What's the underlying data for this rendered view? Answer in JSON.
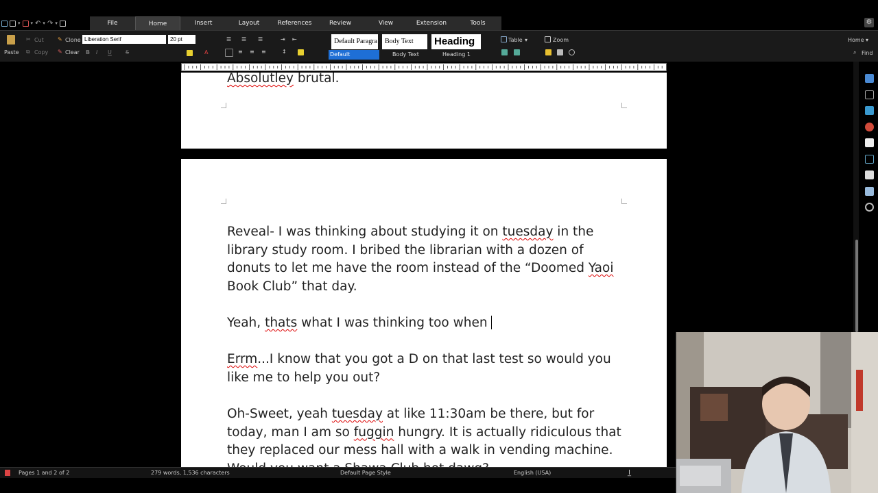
{
  "tabs": [
    "File",
    "Home",
    "Insert",
    "Layout",
    "References",
    "Review",
    "View",
    "Extension",
    "Tools"
  ],
  "active_tab": "Home",
  "ribbon": {
    "cut": "Cut",
    "copy": "Copy",
    "paste": "Paste",
    "clone": "Clone",
    "clear": "Clear",
    "font_name": "Liberation Serif",
    "font_size": "20 pt",
    "styles": [
      {
        "preview": "Default Paragra",
        "label": "Default Paragraph..."
      },
      {
        "preview": "Body Text",
        "label": "Body Text"
      },
      {
        "preview": "Heading",
        "label": "Heading 1"
      }
    ],
    "table": "Table",
    "zoom": "Zoom",
    "home": "Home",
    "find": "Find"
  },
  "document": {
    "page1_tail": "Absolutley brutal.",
    "paragraphs": [
      "Reveal- I was thinking about studying it on tuesday in the library study room. I bribed the librarian with a dozen of donuts to let me have the room instead of the “Doomed Yaoi Book Club” that day.",
      "Yeah, thats what I was thinking too when",
      "Errm...I know that you got a D on that last test so would you like me to help you out?",
      "Oh-Sweet, yeah tuesday at like 11:30am be there, but for today, man I am so fuggin hungry. It is actually ridiculous that they replaced our mess hall with a walk in vending machine. Would you want a Shawa Club hot dawg?"
    ]
  },
  "status": {
    "pages": "Pages 1 and 2 of 2",
    "words": "279 words, 1,536 characters",
    "page_style": "Default Page Style",
    "language": "English (USA)"
  },
  "colors": {
    "accent": "#1e6fd6",
    "spellcheck": "#dd0000"
  }
}
